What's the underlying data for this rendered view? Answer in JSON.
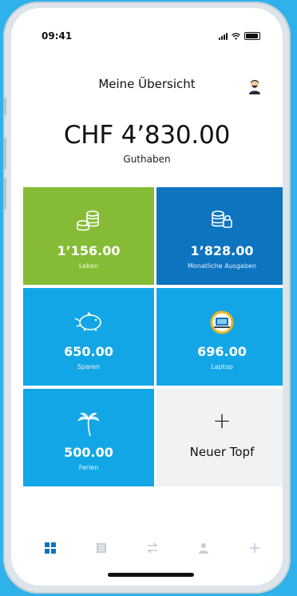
{
  "status_bar": {
    "time": "09:41"
  },
  "header": {
    "title": "Meine Übersicht"
  },
  "balance": {
    "amount": "CHF 4’830.00",
    "label": "Guthaben"
  },
  "pots": [
    {
      "amount": "1’156.00",
      "label": "Leben",
      "color": "#86bc35",
      "icon": "coins-icon"
    },
    {
      "amount": "1’828.00",
      "label": "Monatliche Ausgaben",
      "color": "#0d74c0",
      "icon": "locked-coins-icon"
    },
    {
      "amount": "650.00",
      "label": "Sparen",
      "color": "#13a6e6",
      "icon": "piggy-bank-icon"
    },
    {
      "amount": "696.00",
      "label": "Laptop",
      "color": "#13a6e6",
      "icon": "laptop-icon"
    },
    {
      "amount": "500.00",
      "label": "Ferien",
      "color": "#13a6e6",
      "icon": "palm-tree-icon"
    }
  ],
  "new_pot": {
    "label": "Neuer Topf",
    "icon": "plus-icon"
  },
  "navigation": [
    {
      "icon": "dashboard-icon",
      "active": true
    },
    {
      "icon": "list-icon",
      "active": false
    },
    {
      "icon": "transfer-icon",
      "active": false
    },
    {
      "icon": "profile-icon",
      "active": false
    },
    {
      "icon": "plus-icon",
      "active": false
    }
  ],
  "colors": {
    "background": "#2fb1ea",
    "active_nav": "#0d74c0",
    "inactive_nav": "#c5ccd3"
  }
}
